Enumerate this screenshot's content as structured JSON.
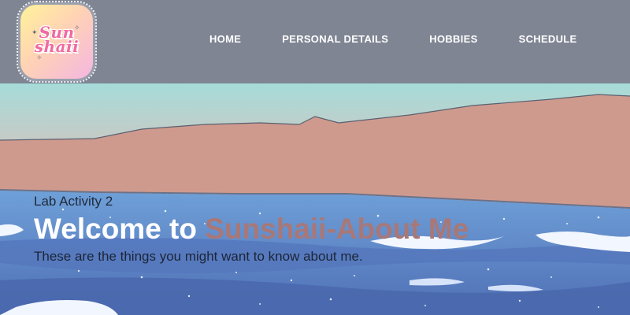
{
  "logo": {
    "text": "Sun shaii",
    "icon": "sun-logo"
  },
  "nav": {
    "items": [
      {
        "label": "HOME"
      },
      {
        "label": "PERSONAL DETAILS"
      },
      {
        "label": "HOBBIES"
      },
      {
        "label": "SCHEDULE"
      }
    ]
  },
  "hero": {
    "lab_title": "Lab Activity 2",
    "welcome_prefix": "Welcome to ",
    "welcome_accent": "Sunshaii-About Me",
    "subtitle": "These are the things you might want to know about me."
  },
  "colors": {
    "header_bg": "#7f8593",
    "sky": "#9fd6d8",
    "mountain": "#cf9a8e",
    "sea": "#5f86c9",
    "accent": "#a87878"
  }
}
